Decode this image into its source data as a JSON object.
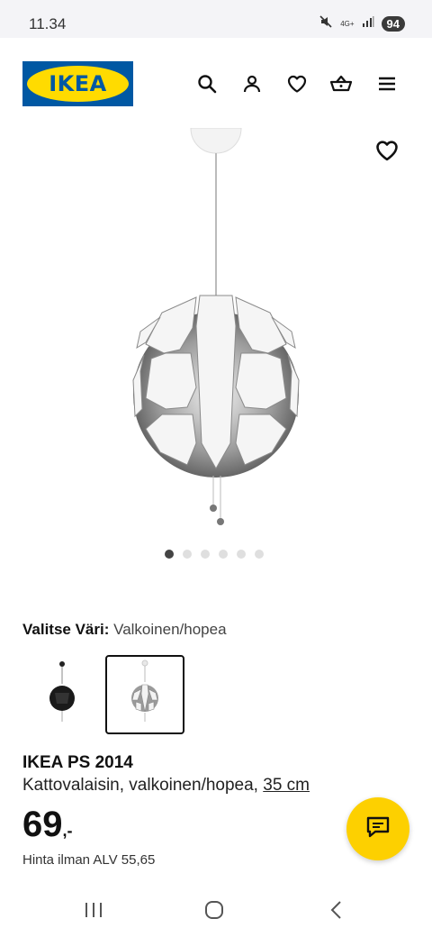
{
  "status_bar": {
    "time": "11.34",
    "network": "4G+",
    "battery": "94"
  },
  "header": {
    "logo_text": "IKEA",
    "icons": [
      "search-icon",
      "profile-icon",
      "heart-icon",
      "basket-icon",
      "menu-icon"
    ]
  },
  "gallery": {
    "image": "pendant-lamp-white-silver",
    "total_images": 6,
    "active_index": 0
  },
  "color_selector": {
    "label": "Valitse Väri:",
    "selected_value": "Valkoinen/hopea",
    "options": [
      {
        "name": "black"
      },
      {
        "name": "white-silver",
        "selected": true
      }
    ]
  },
  "product": {
    "name": "IKEA PS 2014",
    "description": "Kattovalaisin, valkoinen/hopea,",
    "size": "35 cm",
    "price": "69",
    "price_suffix": ",-",
    "price_excl_vat": "Hinta ilman ALV 55,65"
  },
  "colors": {
    "ikea_blue": "#0058a3",
    "ikea_yellow": "#ffdb00",
    "chat_yellow": "#fdd000"
  }
}
